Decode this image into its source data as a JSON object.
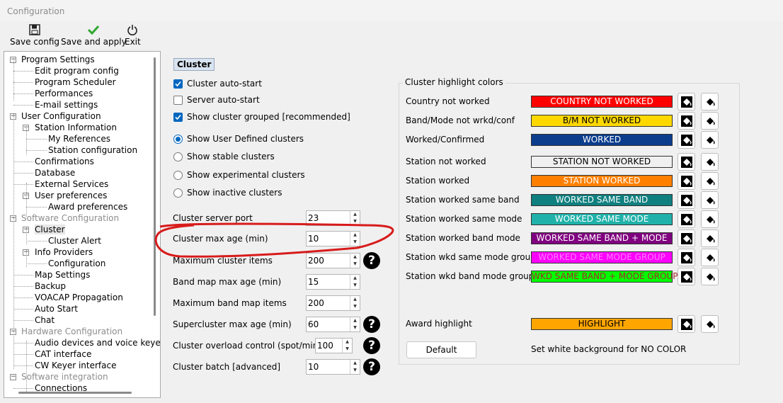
{
  "window": {
    "title": "Configuration"
  },
  "toolbar": {
    "save_config": "Save config",
    "save_apply": "Save and apply",
    "exit": "Exit"
  },
  "tree": {
    "items": [
      {
        "label": "Program Settings",
        "level": 0,
        "expander": "-",
        "dim": false
      },
      {
        "label": "Edit program config",
        "level": 1,
        "dim": false
      },
      {
        "label": "Program Scheduler",
        "level": 1,
        "dim": false
      },
      {
        "label": "Performances",
        "level": 1,
        "dim": false
      },
      {
        "label": "E-mail settings",
        "level": 1,
        "dim": false
      },
      {
        "label": "User Configuration",
        "level": 0,
        "expander": "-",
        "dim": false
      },
      {
        "label": "Station Information",
        "level": 1,
        "expander": "-",
        "dim": false
      },
      {
        "label": "My References",
        "level": 2,
        "dim": false
      },
      {
        "label": "Station configuration",
        "level": 2,
        "dim": false
      },
      {
        "label": "Confirmations",
        "level": 1,
        "dim": false
      },
      {
        "label": "Database",
        "level": 1,
        "dim": false
      },
      {
        "label": "External Services",
        "level": 1,
        "dim": false
      },
      {
        "label": "User preferences",
        "level": 1,
        "expander": "-",
        "dim": false
      },
      {
        "label": "Award preferences",
        "level": 2,
        "dim": false
      },
      {
        "label": "Software Configuration",
        "level": 0,
        "expander": "-",
        "dim": true
      },
      {
        "label": "Cluster",
        "level": 1,
        "expander": "-",
        "dim": false,
        "selected": true
      },
      {
        "label": "Cluster Alert",
        "level": 2,
        "dim": false
      },
      {
        "label": "Info Providers",
        "level": 1,
        "expander": "-",
        "dim": false
      },
      {
        "label": "Configuration",
        "level": 2,
        "dim": false
      },
      {
        "label": "Map Settings",
        "level": 1,
        "dim": false
      },
      {
        "label": "Backup",
        "level": 1,
        "dim": false
      },
      {
        "label": "VOACAP Propagation",
        "level": 1,
        "dim": false
      },
      {
        "label": "Auto Start",
        "level": 1,
        "dim": false
      },
      {
        "label": "Chat",
        "level": 1,
        "dim": false
      },
      {
        "label": "Hardware Configuration",
        "level": 0,
        "expander": "-",
        "dim": true
      },
      {
        "label": "Audio devices and voice keye",
        "level": 1,
        "dim": false
      },
      {
        "label": "CAT interface",
        "level": 1,
        "dim": false
      },
      {
        "label": "CW Keyer interface",
        "level": 1,
        "dim": false
      },
      {
        "label": "Software integration",
        "level": 0,
        "expander": "-",
        "dim": true
      },
      {
        "label": "Connections",
        "level": 1,
        "dim": false
      }
    ]
  },
  "cluster": {
    "title": "Cluster",
    "checkboxes": [
      {
        "label": "Cluster auto-start",
        "checked": true
      },
      {
        "label": "Server auto-start",
        "checked": false
      },
      {
        "label": "Show cluster grouped [recommended]",
        "checked": true
      }
    ],
    "radios": [
      {
        "label": "Show User Defined clusters",
        "selected": true
      },
      {
        "label": "Show stable clusters",
        "selected": false
      },
      {
        "label": "Show experimental clusters",
        "selected": false
      },
      {
        "label": "Show inactive clusters",
        "selected": false
      }
    ],
    "fields": [
      {
        "label": "Cluster server port",
        "value": "23",
        "help": false
      },
      {
        "label": "Cluster max age (min)",
        "value": "10",
        "help": false
      },
      {
        "label": "Maximum cluster items",
        "value": "200",
        "help": true
      },
      {
        "label": "Band map max age (min)",
        "value": "15",
        "help": false
      },
      {
        "label": "Maximum band map items",
        "value": "200",
        "help": false
      },
      {
        "label": "Supercluster max age (min)",
        "value": "60",
        "help": true
      },
      {
        "label": "Cluster overload control (spot/min)",
        "value": "100",
        "help": true
      },
      {
        "label": "Cluster batch [advanced]",
        "value": "10",
        "help": true
      }
    ]
  },
  "highlight": {
    "group_title": "Cluster highlight colors",
    "rows": [
      {
        "label": "Country not worked",
        "text": "COUNTRY NOT WORKED",
        "bg": "#ff0000",
        "fg": "#ffffff"
      },
      {
        "label": "Band/Mode not wrkd/conf",
        "text": "B/M NOT WORKED",
        "bg": "#ffd800",
        "fg": "#000000"
      },
      {
        "label": "Worked/Confirmed",
        "text": "WORKED",
        "bg": "#0b3d8c",
        "fg": "#ffffff"
      },
      {
        "label": "Station not worked",
        "text": "STATION NOT WORKED",
        "bg": "#f0f0f0",
        "fg": "#000000"
      },
      {
        "label": "Station worked",
        "text": "STATION WORKED",
        "bg": "#ff8000",
        "fg": "#ffffff"
      },
      {
        "label": "Station worked same band",
        "text": "WORKED SAME BAND",
        "bg": "#0f7f7f",
        "fg": "#ffffff"
      },
      {
        "label": "Station worked same mode",
        "text": "WORKED SAME MODE",
        "bg": "#20b2aa",
        "fg": "#ffffff"
      },
      {
        "label": "Station worked band mode",
        "text": "WORKED SAME BAND + MODE",
        "bg": "#800080",
        "fg": "#ffffff"
      },
      {
        "label": "Station wkd same mode group",
        "text": "WORKED SAME MODE GROUP",
        "bg": "#ff00ff",
        "fg": "#ff80ff"
      },
      {
        "label": "Station wkd band mode group",
        "text": "WKD SAME BAND + MODE GROUP",
        "bg": "#00ff00",
        "fg": "#a52a2a"
      }
    ],
    "award": {
      "label": "Award highlight",
      "text": "HIGHLIGHT",
      "bg": "#ffa500",
      "fg": "#000000"
    },
    "default_button": "Default",
    "note": "Set white background for NO COLOR"
  },
  "colors": {
    "annotation": "#d81b1b",
    "accent": "#0067c0"
  }
}
